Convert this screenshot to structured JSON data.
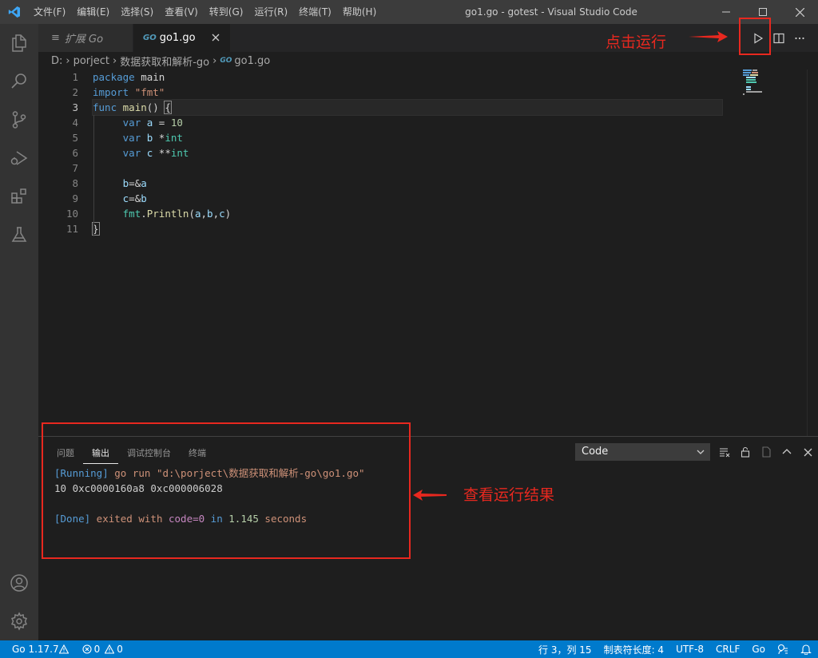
{
  "window": {
    "title": "go1.go - gotest - Visual Studio Code",
    "menus": [
      "文件(F)",
      "编辑(E)",
      "选择(S)",
      "查看(V)",
      "转到(G)",
      "运行(R)",
      "终端(T)",
      "帮助(H)"
    ]
  },
  "tabs": {
    "inactive": {
      "glyph": "≡",
      "label": "扩展 Go"
    },
    "active": {
      "glyph": "GO",
      "label": "go1.go"
    }
  },
  "breadcrumb": {
    "segments": [
      "D:",
      "porject",
      "数据获取和解析-go",
      "go1.go"
    ],
    "file_glyph": "GO"
  },
  "editor": {
    "line_numbers": [
      "1",
      "2",
      "3",
      "4",
      "5",
      "6",
      "7",
      "8",
      "9",
      "10",
      "11"
    ],
    "current_line": 3
  },
  "panel": {
    "tabs": [
      "问题",
      "输出",
      "调试控制台",
      "终端"
    ],
    "active_tab": "输出",
    "channel": "Code",
    "output": {
      "running_tag": "[Running]",
      "running_cmd": " go run \"d:\\porject\\数据获取和解析-go\\go1.go\"",
      "result": "10 0xc0000160a8 0xc000006028",
      "done_tag": "[Done]",
      "done_pre": " exited with ",
      "done_code": "code=0",
      "done_in": " in ",
      "done_seconds": "1.145",
      "done_unit": " seconds"
    }
  },
  "statusbar": {
    "go_version": "Go 1.17.7",
    "errors": "0",
    "warnings": "0",
    "position": "行 3，列 15",
    "tab_size": "制表符长度: 4",
    "encoding": "UTF-8",
    "eol": "CRLF",
    "language": "Go"
  },
  "annotations": {
    "run_label": "点击运行",
    "result_label": "查看运行结果"
  },
  "colors": {
    "accent": "#007acc",
    "annotation": "#e8281f",
    "go_icon": "#519aba"
  }
}
